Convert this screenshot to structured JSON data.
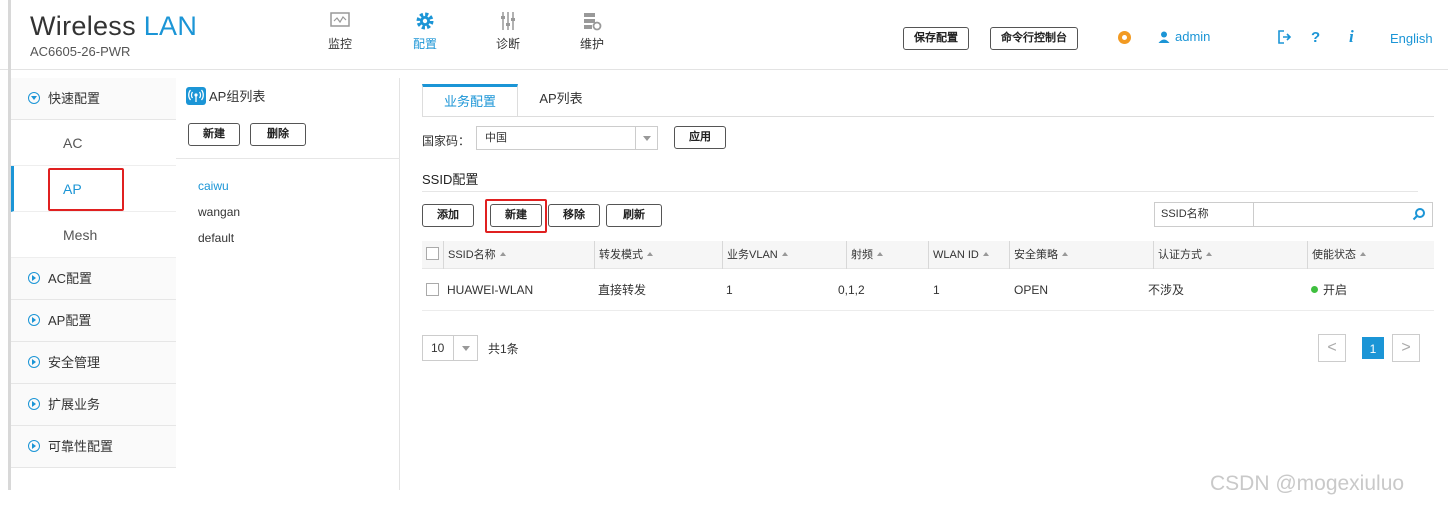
{
  "brand": {
    "title_a": "Wireless ",
    "title_b": "LAN",
    "model": "AC6605-26-PWR"
  },
  "nav": [
    {
      "label": "监控",
      "icon": "monitor-icon"
    },
    {
      "label": "配置",
      "icon": "gear-icon",
      "active": true
    },
    {
      "label": "诊断",
      "icon": "sliders-icon"
    },
    {
      "label": "维护",
      "icon": "maintenance-icon"
    }
  ],
  "header": {
    "save_config": "保存配置",
    "cli_console": "命令行控制台",
    "user": "admin",
    "language": "English",
    "help": "?",
    "info": "i"
  },
  "side": {
    "quick": "快速配置",
    "ac": "AC",
    "ap": "AP",
    "mesh": "Mesh",
    "ac_config": "AC配置",
    "ap_config": "AP配置",
    "security": "安全管理",
    "extension": "扩展业务",
    "reliability": "可靠性配置"
  },
  "group": {
    "title": "AP组列表",
    "new": "新建",
    "delete": "删除",
    "items": [
      "caiwu",
      "wangan",
      "default"
    ]
  },
  "tabs": {
    "service": "业务配置",
    "ap_list": "AP列表"
  },
  "country": {
    "label": "国家码：",
    "value": "中国",
    "apply": "应用"
  },
  "ssid": {
    "title": "SSID配置",
    "add": "添加",
    "new": "新建",
    "remove": "移除",
    "refresh": "刷新",
    "search_label": "SSID名称",
    "search_value": ""
  },
  "table": {
    "headers": [
      "SSID名称",
      "转发模式",
      "业务VLAN",
      "射频",
      "WLAN ID",
      "安全策略",
      "认证方式",
      "使能状态"
    ],
    "rows": [
      [
        "HUAWEI-WLAN",
        "直接转发",
        "1",
        "0,1,2",
        "1",
        "OPEN",
        "不涉及",
        "开启"
      ]
    ]
  },
  "pager": {
    "size": "10",
    "total": "共1条",
    "current": "1",
    "prev": "<",
    "next": ">"
  },
  "watermark": "CSDN @mogexiuluo",
  "colors": {
    "accent": "#1b95d6",
    "highlight": "#e02020",
    "enabled": "#3fbf3f"
  }
}
